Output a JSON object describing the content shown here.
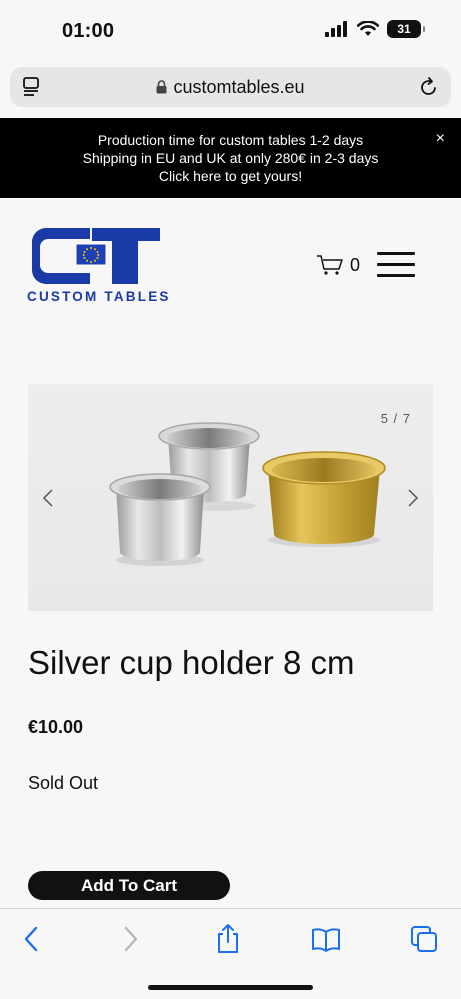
{
  "status_bar": {
    "time": "01:00",
    "battery": "31"
  },
  "browser": {
    "url": "customtables.eu"
  },
  "promo": {
    "line1": "Production time for custom tables 1-2 days",
    "line2": "Shipping in EU and UK at only 280€ in 2-3 days",
    "line3": "Click here to get yours!",
    "close": "×"
  },
  "header": {
    "brand": "CUSTOM TABLES",
    "cart_count": "0"
  },
  "gallery": {
    "counter": "5 / 7"
  },
  "product": {
    "title": "Silver cup holder 8 cm",
    "price": "€10.00",
    "stock": "Sold Out",
    "add_to_cart": "Add To Cart"
  },
  "colors": {
    "brand_blue": "#1a3aa8",
    "accent_black": "#000000",
    "gold": "#c9a638"
  }
}
